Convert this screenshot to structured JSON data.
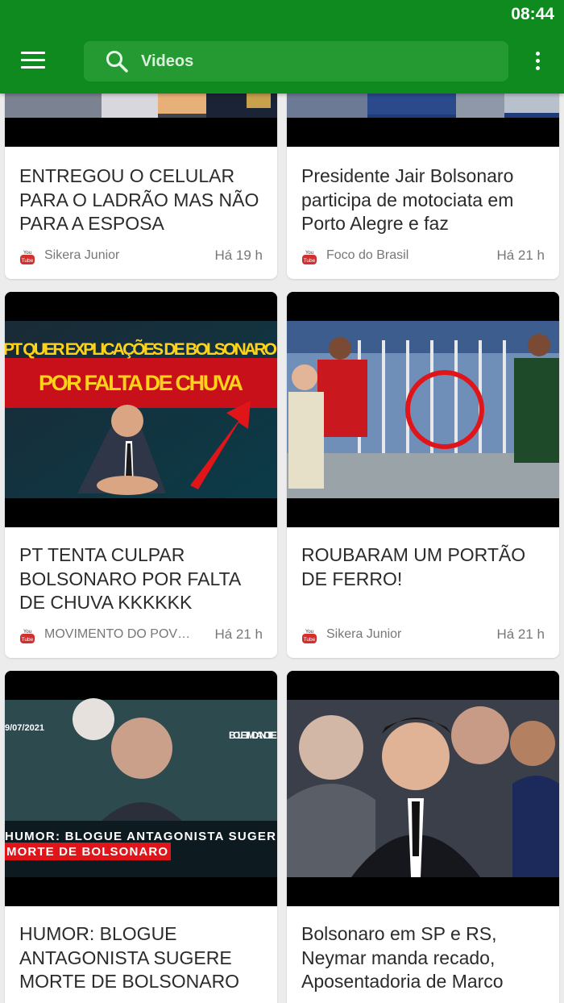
{
  "status_bar": {
    "time": "08:44"
  },
  "app_bar": {
    "menu_icon": "hamburger-menu-icon",
    "search_placeholder": "Videos",
    "search_icon": "search-icon",
    "more_icon": "more-vert-icon"
  },
  "colors": {
    "primary": "#0f8a1e",
    "search_bg": "#259a33",
    "card_bg": "#ffffff",
    "page_bg": "#ececec",
    "youtube_red": "#d32f2f"
  },
  "videos": [
    {
      "title": "ENTREGOU O CELULAR PARA O LADRÃO MAS NÃO PARA A ESPOSA",
      "source": "Sikera Junior",
      "time": "Há 19 h",
      "source_icon": "youtube-icon"
    },
    {
      "title": "Presidente Jair Bolsonaro participa de motociata em Porto Alegre e faz",
      "source": "Foco do Brasil",
      "time": "Há 21 h",
      "source_icon": "youtube-icon"
    },
    {
      "title": "PT TENTA CULPAR BOLSONARO POR FALTA DE CHUVA KKKKKK",
      "source": "MOVIMENTO DO POVO ...",
      "time": "Há 21 h",
      "source_icon": "youtube-icon",
      "thumb_texts": [
        "PT QUER EXPLICAÇÕES DE BOLSONARO",
        "POR FALTA DE CHUVA"
      ]
    },
    {
      "title": "ROUBARAM UM PORTÃO DE FERRO!",
      "source": "Sikera Junior",
      "time": "Há 21 h",
      "source_icon": "youtube-icon"
    },
    {
      "title": "HUMOR: BLOGUE ANTAGONISTA SUGERE MORTE DE BOLSONARO",
      "source_icon": "youtube-icon",
      "thumb_texts": [
        "9/07/2021",
        "BOLETIM DA NOITE",
        "HUMOR: BLOGUE ANTAGONISTA SUGER",
        "MORTE DE BOLSONARO"
      ]
    },
    {
      "title": "Bolsonaro em SP e RS, Neymar manda recado, Aposentadoria de Marco",
      "source_icon": "youtube-icon"
    }
  ]
}
